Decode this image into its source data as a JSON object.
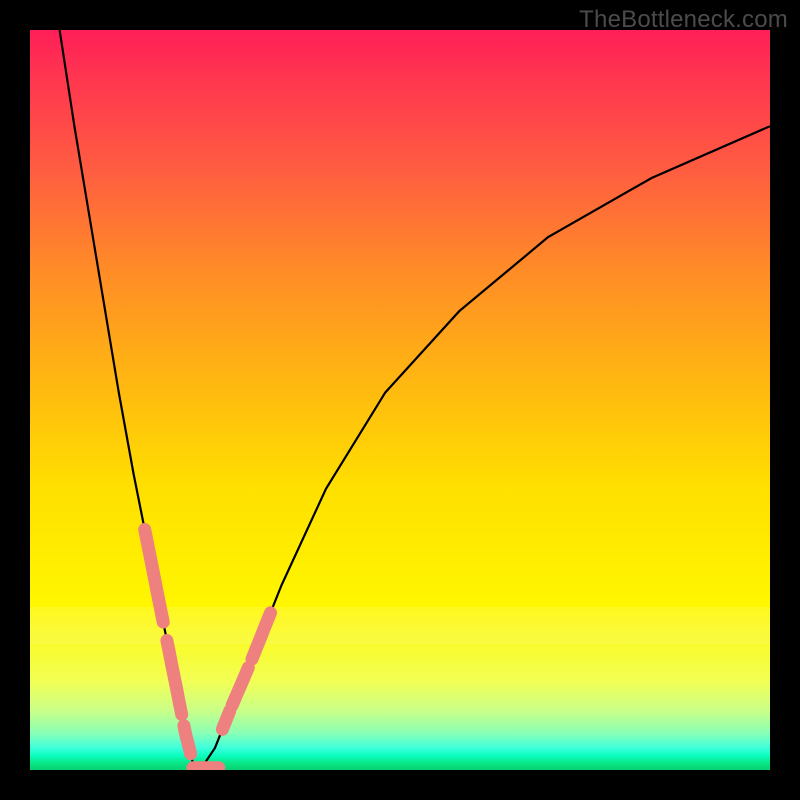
{
  "watermark": "TheBottleneck.com",
  "colors": {
    "background": "#000000",
    "curve": "#000000",
    "segments": "#ef8080",
    "gradient_top": "#ff1f58",
    "gradient_mid": "#ffe000",
    "gradient_bottom": "#08d070"
  },
  "chart_data": {
    "type": "line",
    "title": "",
    "xlabel": "",
    "ylabel": "",
    "xlim": [
      0,
      100
    ],
    "ylim": [
      0,
      100
    ],
    "note": "Two gradient-background V-curve branches meeting near x≈23, y=0; values estimated from pixel positions on a 0–100 normalized scale",
    "series": [
      {
        "name": "left-branch",
        "x": [
          4,
          6,
          8,
          10,
          12,
          14,
          16,
          18,
          20,
          21,
          22,
          23
        ],
        "y": [
          100,
          87,
          75,
          63,
          51,
          40,
          30,
          20,
          10,
          5,
          1,
          0
        ]
      },
      {
        "name": "right-branch",
        "x": [
          23,
          25,
          27,
          30,
          34,
          40,
          48,
          58,
          70,
          84,
          100
        ],
        "y": [
          0,
          3,
          8,
          15,
          25,
          38,
          51,
          62,
          72,
          80,
          87
        ]
      }
    ],
    "highlighted_segments": [
      {
        "branch": "left",
        "x_range": [
          15.5,
          18.0
        ]
      },
      {
        "branch": "left",
        "x_range": [
          18.5,
          20.5
        ]
      },
      {
        "branch": "left",
        "x_range": [
          20.8,
          21.7
        ]
      },
      {
        "branch": "bottom",
        "x_range": [
          22.0,
          25.5
        ]
      },
      {
        "branch": "right",
        "x_range": [
          26.0,
          27.0
        ]
      },
      {
        "branch": "right",
        "x_range": [
          27.3,
          29.5
        ]
      },
      {
        "branch": "right",
        "x_range": [
          30.0,
          32.5
        ]
      }
    ]
  }
}
